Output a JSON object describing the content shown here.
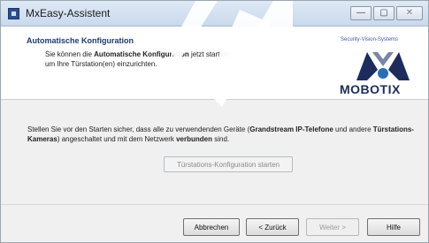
{
  "window": {
    "title": "MxEasy-Assistent",
    "controls": {
      "minimize": "—",
      "maximize": "▢",
      "close": "✕"
    }
  },
  "header": {
    "title": "Automatische Konfiguration",
    "line1_prefix": "Sie können die ",
    "line1_bold": "Automatische Konfiguration",
    "line1_suffix": " jetzt starten,",
    "line2": "um Ihre Türstation(en) einzurichten."
  },
  "logo": {
    "tagline": "Security-Vision-Systems",
    "brand": "MOBOTIX"
  },
  "body": {
    "p1": "Stellen Sie vor den Starten sicher, dass alle zu verwendenden Geräte (",
    "b1": "Grandstream IP-Telefone",
    "p2": " und andere ",
    "b2": "Türstations-Kameras",
    "p3": ") angeschaltet und mit dem Netzwerk ",
    "b3": "verbunden",
    "p4": " sind."
  },
  "config_button": "Türstations-Konfiguration starten",
  "footer": {
    "cancel": "Abbrechen",
    "back": "< Zurück",
    "next": "Weiter >",
    "help": "Hilfe"
  },
  "colors": {
    "header_title": "#1f3a78",
    "brand": "#1d2c5c"
  }
}
